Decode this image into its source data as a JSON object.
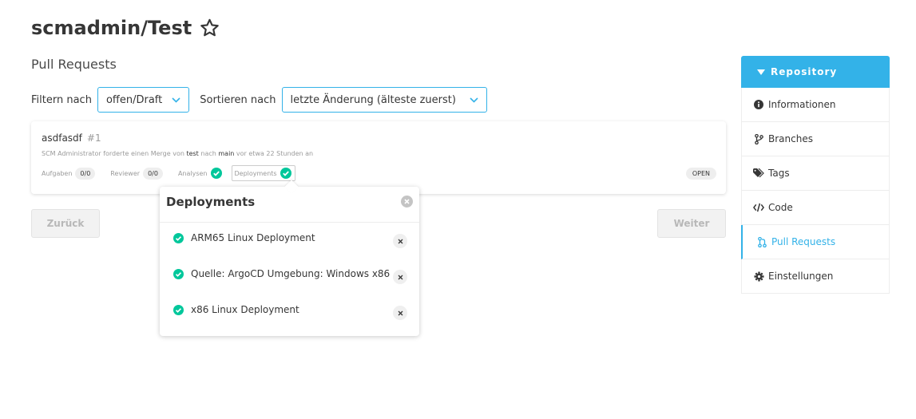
{
  "repo": {
    "title": "scmadmin/Test"
  },
  "page": {
    "subtitle": "Pull Requests"
  },
  "filters": {
    "filter_label": "Filtern nach",
    "filter_value": "offen/Draft",
    "sort_label": "Sortieren nach",
    "sort_value": "letzte Änderung (älteste zuerst)"
  },
  "pull_request": {
    "title": "asdfasdf",
    "number": "#1",
    "meta_prefix": "SCM Administrator forderte einen Merge von",
    "source_branch": "test",
    "meta_middle": "nach",
    "target_branch": "main",
    "meta_suffix": "vor etwa 22 Stunden an",
    "tasks_label": "Aufgaben",
    "tasks_count": "0/0",
    "reviewer_label": "Reviewer",
    "reviewer_count": "0/0",
    "analyses_label": "Analysen",
    "deployments_label": "Deployments",
    "status": "OPEN"
  },
  "pagination": {
    "back_label": "Zurück",
    "next_label": "Weiter"
  },
  "popover": {
    "title": "Deployments",
    "items": [
      {
        "label": "ARM65 Linux Deployment"
      },
      {
        "label": "Quelle: ArgoCD Umgebung: Windows x86"
      },
      {
        "label": "x86 Linux Deployment"
      }
    ]
  },
  "sidebar": {
    "header": "Repository",
    "items": [
      {
        "label": "Informationen",
        "icon": "info-circle-icon"
      },
      {
        "label": "Branches",
        "icon": "branch-icon"
      },
      {
        "label": "Tags",
        "icon": "tags-icon"
      },
      {
        "label": "Code",
        "icon": "code-icon"
      },
      {
        "label": "Pull Requests",
        "icon": "pull-request-icon",
        "active": true
      },
      {
        "label": "Einstellungen",
        "icon": "cog-icon"
      }
    ]
  },
  "colors": {
    "accent": "#33b2e8",
    "success": "#00c79b",
    "text": "#363636",
    "muted": "#9a9a9a"
  }
}
